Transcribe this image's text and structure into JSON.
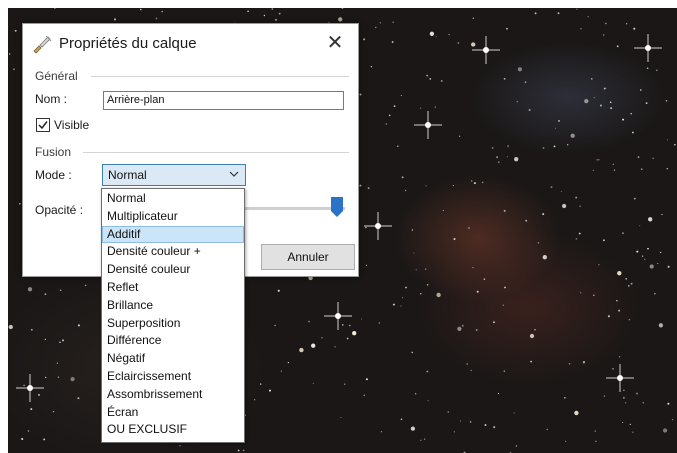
{
  "dialog": {
    "title": "Propriétés du calque",
    "title_icon": "brush-icon",
    "close_label": "✕",
    "general_group": "Général",
    "name_label": "Nom :",
    "name_value": "Arrière-plan",
    "visible_label": "Visible",
    "visible_checked": true,
    "fusion_group": "Fusion",
    "mode_label": "Mode :",
    "mode_value": "Normal",
    "opacity_label": "Opacité :",
    "opacity_level": 1.0,
    "cancel_label": "Annuler"
  },
  "mode_dropdown": {
    "highlighted": "Additif",
    "options": [
      "Normal",
      "Multiplicateur",
      "Additif",
      "Densité couleur +",
      "Densité couleur",
      "Reflet",
      "Brillance",
      "Superposition",
      "Différence",
      "Négatif",
      "Eclaircissement",
      "Assombrissement",
      "Écran",
      "OU EXCLUSIF"
    ]
  },
  "colors": {
    "accent": "#3c7fb1",
    "slider_thumb": "#2a73c7",
    "highlight": "#cce4f7"
  }
}
